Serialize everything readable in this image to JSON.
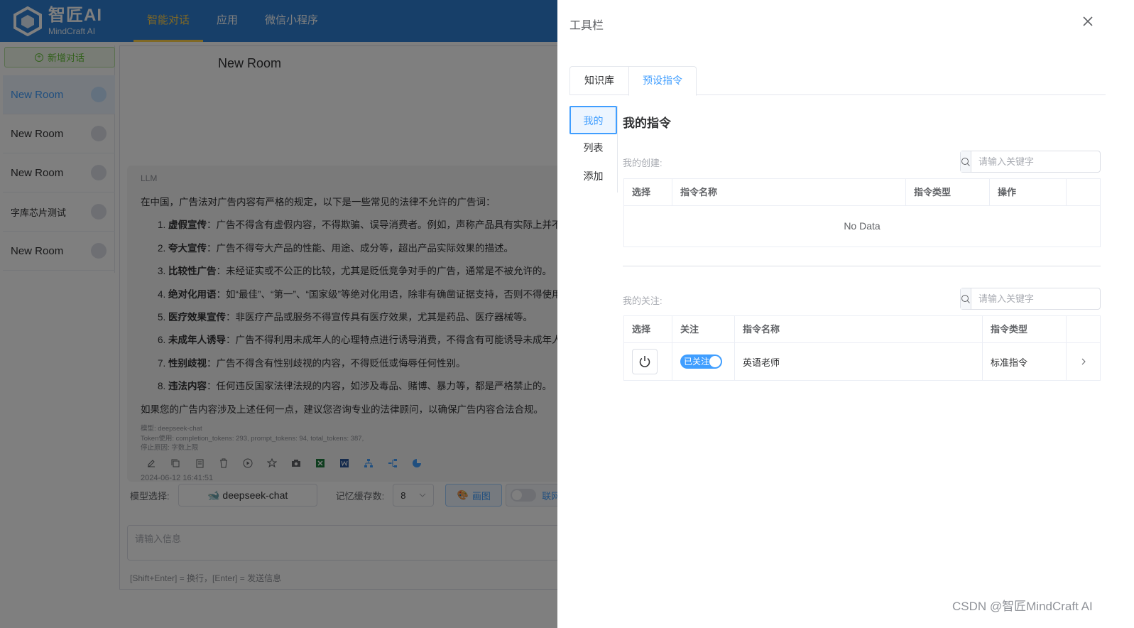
{
  "app": {
    "logo_title": "智匠AI",
    "logo_sub": "MindCraft AI",
    "brand_color": "#2f7fd3",
    "accent_color": "#409eff",
    "nav": [
      {
        "label": "智能对话",
        "active": true
      },
      {
        "label": "应用",
        "active": false
      },
      {
        "label": "微信小程序",
        "active": false
      }
    ]
  },
  "sidebar": {
    "new_chat_label": "新增对话",
    "rooms": [
      {
        "label": "New Room",
        "active": true
      },
      {
        "label": "New Room",
        "active": false
      },
      {
        "label": "New Room",
        "active": false
      },
      {
        "label": "字库芯片测试",
        "active": false
      },
      {
        "label": "New Room",
        "active": false
      }
    ]
  },
  "chat": {
    "room_title": "New Room",
    "message": {
      "role": "LLM",
      "intro": "在中国，广告法对广告内容有严格的规定，以下是一些常见的法律不允许的广告词：",
      "items": [
        {
          "num": "1.",
          "title": "虚假宣传",
          "text": "：广告不得含有虚假内容，不得欺骗、误导消费者。例如，声称产品具有实际上并不具备的功能或效果。"
        },
        {
          "num": "2.",
          "title": "夸大宣传",
          "text": "：广告不得夸大产品的性能、用途、成分等，超出产品实际效果的描述。"
        },
        {
          "num": "3.",
          "title": "比较性广告",
          "text": "：未经证实或不公正的比较，尤其是贬低竞争对手的广告，通常是不被允许的。"
        },
        {
          "num": "4.",
          "title": "绝对化用语",
          "text": "：如“最佳”、“第一”、“国家级”等绝对化用语，除非有确凿证据支持，否则不得使用。"
        },
        {
          "num": "5.",
          "title": "医疗效果宣传",
          "text": "：非医疗产品或服务不得宣传具有医疗效果，尤其是药品、医疗器械等。"
        },
        {
          "num": "6.",
          "title": "未成年人诱导",
          "text": "：广告不得利用未成年人的心理特点进行诱导消费，不得含有可能诱导未成年人做出危险行为的内容。"
        },
        {
          "num": "7.",
          "title": "性别歧视",
          "text": "：广告不得含有性别歧视的内容，不得贬低或侮辱任何性别。"
        },
        {
          "num": "8.",
          "title": "违法内容",
          "text": "：任何违反国家法律法规的内容，如涉及毒品、赌博、暴力等，都是严格禁止的。"
        }
      ],
      "outro": "如果您的广告内容涉及上述任何一点，建议您咨询专业的法律顾问，以确保广告内容合法合规。",
      "meta_model": "模型: deepseek-chat",
      "meta_tokens": "Token使用: completion_tokens: 293, prompt_tokens: 94, total_tokens: 387,",
      "meta_stop": "停止原因: 字数上限",
      "time": "2024-06-12 16:41:51",
      "tools": [
        "edit-icon",
        "copy-icon",
        "copy-text-icon",
        "delete-icon",
        "play-icon",
        "star-icon",
        "camera-icon",
        "excel-icon",
        "word-icon",
        "mindmap-icon",
        "flowchart-icon",
        "pie-chart-icon"
      ]
    },
    "model_label": "模型选择:",
    "model_value": "deepseek-chat",
    "memory_label": "记忆缓存数:",
    "memory_value": "8",
    "draw_label": "画图",
    "net_label": "联网",
    "input_placeholder": "请输入信息",
    "input_hint": "[Shift+Enter] = 换行，[Enter] = 发送信息"
  },
  "drawer": {
    "title": "工具栏",
    "tabs": [
      {
        "label": "知识库",
        "active": false
      },
      {
        "label": "预设指令",
        "active": true
      }
    ],
    "side_menu": [
      {
        "label": "我的",
        "active": true
      },
      {
        "label": "列表",
        "active": false
      },
      {
        "label": "添加",
        "active": false
      }
    ],
    "panel_title": "我的指令",
    "created": {
      "label": "我的创建:",
      "search_placeholder": "请输入关键字",
      "headers": [
        "选择",
        "指令名称",
        "指令类型",
        "操作",
        ""
      ],
      "empty_text": "No Data"
    },
    "followed": {
      "label": "我的关注:",
      "search_placeholder": "请输入关键字",
      "headers": [
        "选择",
        "关注",
        "指令名称",
        "指令类型",
        ""
      ],
      "rows": [
        {
          "follow_label": "已关注",
          "name": "英语老师",
          "type": "标准指令"
        }
      ]
    }
  },
  "watermark": "CSDN @智匠MindCraft AI"
}
